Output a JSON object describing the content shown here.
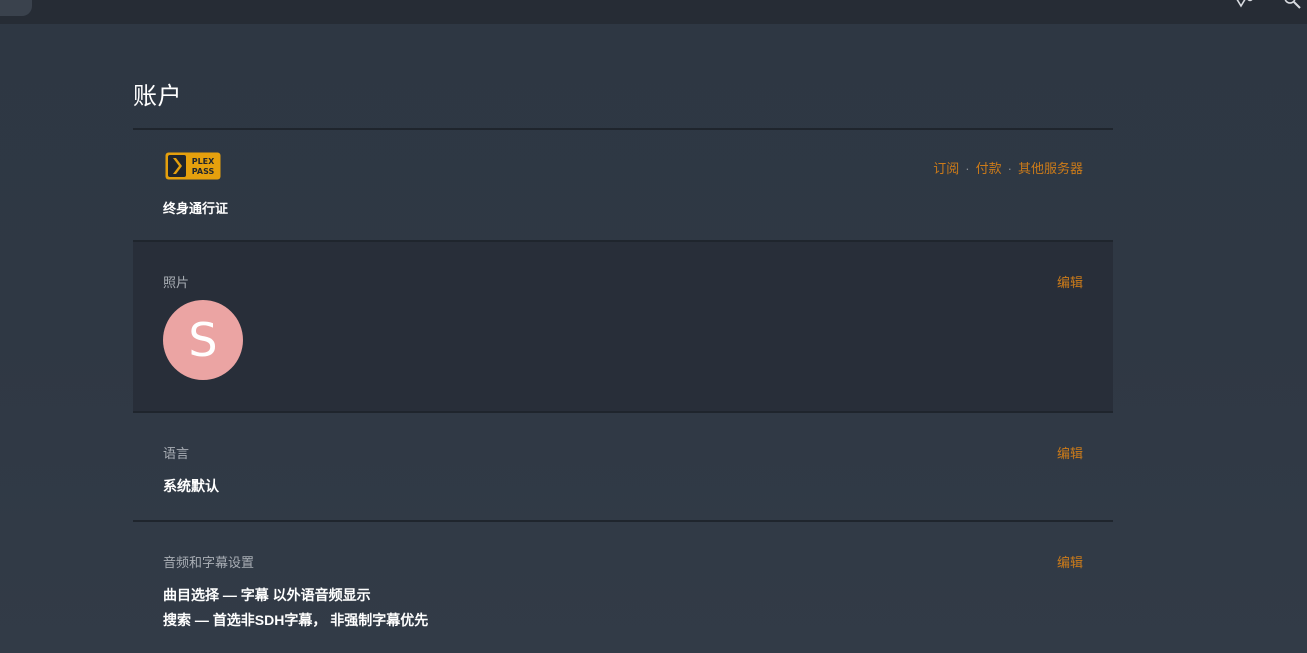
{
  "page": {
    "title": "账户"
  },
  "plex_pass": {
    "logo_text_top": "PLEX",
    "logo_text_bottom": "PASS",
    "value": "终身通行证",
    "links": [
      "订阅",
      "付款",
      "其他服务器"
    ],
    "separator": "·"
  },
  "photo": {
    "label": "照片",
    "edit_label": "编辑",
    "avatar_letter": "S",
    "avatar_color": "#eba4a3"
  },
  "language": {
    "label": "语言",
    "edit_label": "编辑",
    "value": "系统默认"
  },
  "audio_subtitle": {
    "label": "音频和字幕设置",
    "edit_label": "编辑",
    "line1": "曲目选择 — 字幕 以外语音频显示",
    "line2": "搜索 — 首选非SDH字幕， 非强制字幕优先"
  },
  "colors": {
    "accent": "#cc7b19",
    "background": "#2f3844",
    "panel_dark": "#282e39"
  }
}
